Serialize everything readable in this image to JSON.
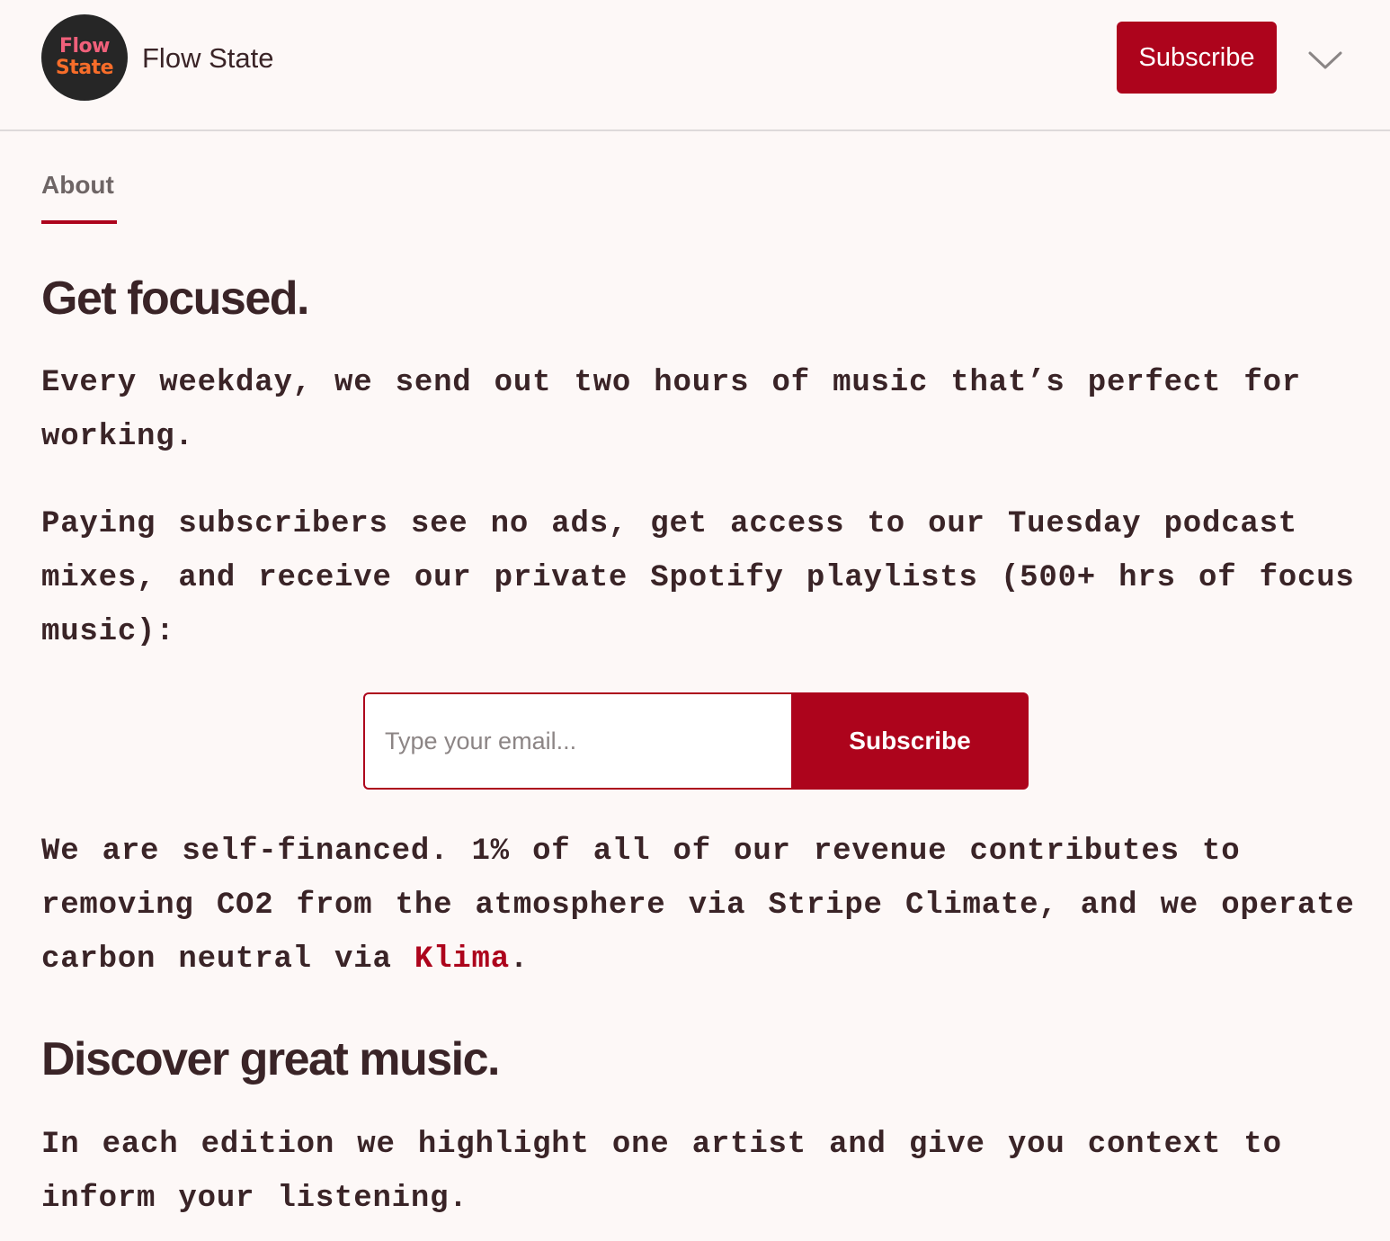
{
  "header": {
    "logo": {
      "line1": "Flow",
      "line2": "State",
      "icon": "flow-state-logo"
    },
    "publication_name": "Flow State",
    "subscribe_label": "Subscribe",
    "menu_icon": "chevron-down-icon"
  },
  "tabs": [
    {
      "label": "About",
      "active": true
    }
  ],
  "content": {
    "heading1": "Get focused.",
    "para1": "Every weekday, we send out two hours of music that’s perfect for working.",
    "para2": "Paying subscribers see no ads, get access to our Tuesday podcast mixes, and receive our private Spotify playlists (500+ hrs of focus music):",
    "form": {
      "email_placeholder": "Type your email...",
      "email_value": "",
      "subscribe_label": "Subscribe"
    },
    "para3": {
      "text_before_link": "We are self-financed. 1% of all of our revenue contributes to removing CO2 from the atmosphere via Stripe Climate, and we operate carbon neutral via ",
      "link_text": "Klima",
      "text_after_link": "."
    },
    "heading2": "Discover great music.",
    "para4": "In each edition we highlight one artist and give you context to inform your listening."
  },
  "colors": {
    "accent": "#ad041c",
    "text": "#3a2427",
    "background": "#fdf8f7",
    "muted": "#6e6565"
  }
}
